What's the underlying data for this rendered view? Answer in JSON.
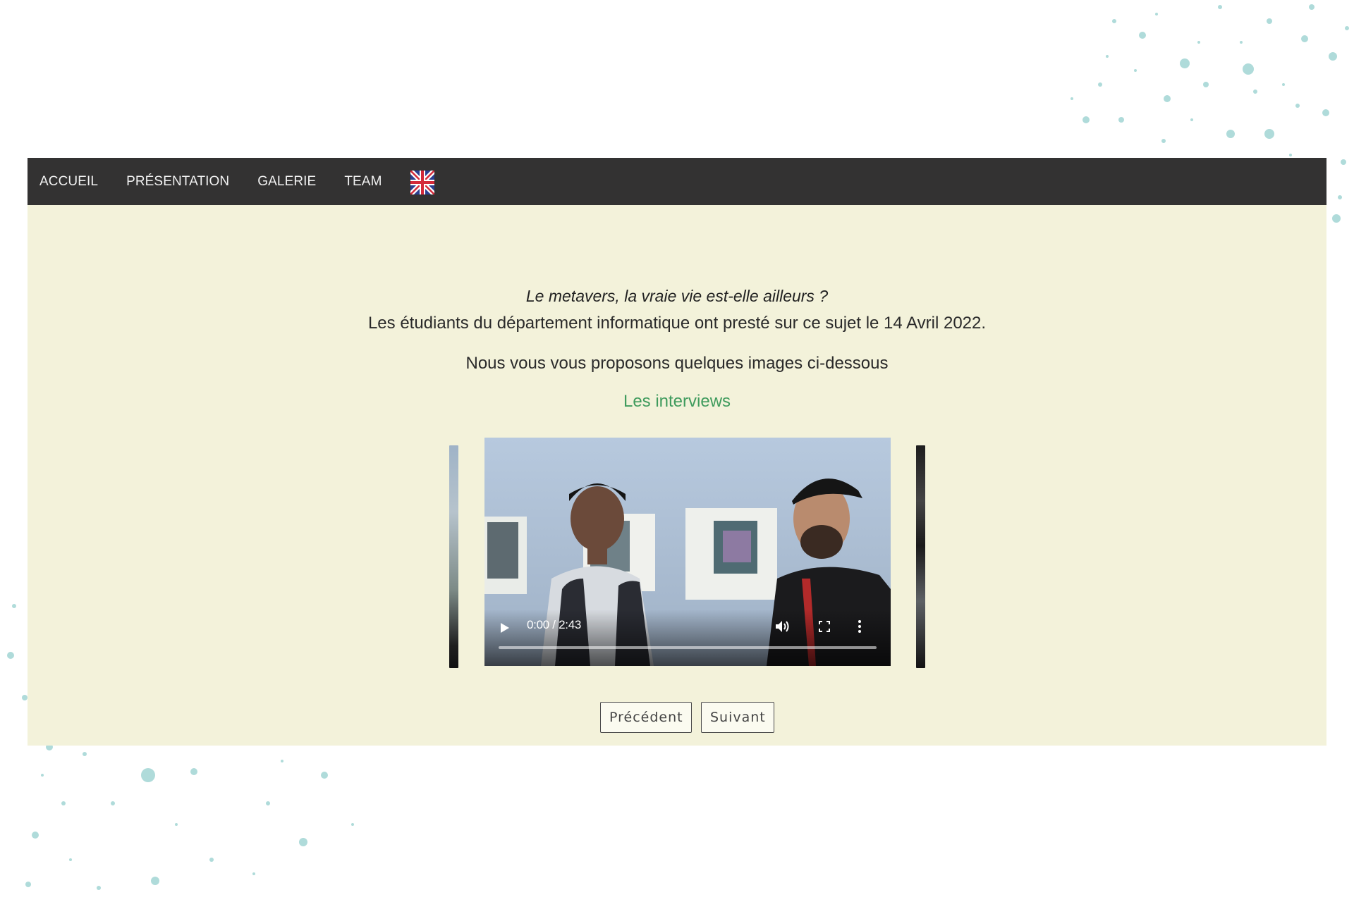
{
  "nav": {
    "items": [
      {
        "label": "ACCUEIL"
      },
      {
        "label": "PRÉSENTATION"
      },
      {
        "label": "GALERIE"
      },
      {
        "label": "TEAM"
      }
    ],
    "language_icon": "uk-flag-icon"
  },
  "intro": {
    "headline": "Le metavers, la vraie vie est-elle ailleurs ?",
    "subline": "Les étudiants du département informatique ont presté sur ce sujet le 14 Avril 2022.",
    "proposal": "Nous vous vous proposons quelques images ci-dessous"
  },
  "section": {
    "heading": "Les interviews"
  },
  "video": {
    "time": "0:00 / 2:43",
    "progress": 0,
    "icons": [
      "play-icon",
      "volume-icon",
      "fullscreen-icon",
      "more-options-icon"
    ]
  },
  "carousel": {
    "prev_label": "Précédent",
    "next_label": "Suivant"
  },
  "colors": {
    "navbar": "#333232",
    "page_background": "#f3f2da",
    "heading_accent": "#3f9b5d",
    "speckle": "#a7d8d6"
  }
}
